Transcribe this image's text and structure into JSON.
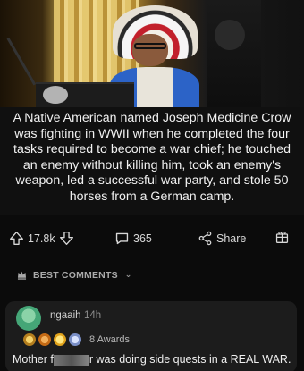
{
  "post": {
    "title": "A Native American named Joseph Medicine Crow was fighting in WWII when he completed the four tasks required to become a war chief; he touched an enemy without killing him, took an enemy's weapon, led a successful war party, and stole 50 horses from a German camp."
  },
  "actions": {
    "upvotes": "17.8k",
    "comments": "365",
    "share_label": "Share"
  },
  "comments_section": {
    "sort_label": "BEST COMMENTS"
  },
  "comment": {
    "username": "ngaaih",
    "time": "14h",
    "awards_label": "8 Awards",
    "text_before": "Mother f",
    "text_after": "r was doing side quests in a REAL WAR."
  },
  "colors": {
    "background": "#0b0b0b",
    "card": "#1c1c1c",
    "text": "#e8e8e8",
    "muted": "#a9a9a9"
  },
  "icons": [
    "upvote-icon",
    "downvote-icon",
    "comment-icon",
    "share-icon",
    "award-icon",
    "crown-icon",
    "chevron-down-icon"
  ]
}
